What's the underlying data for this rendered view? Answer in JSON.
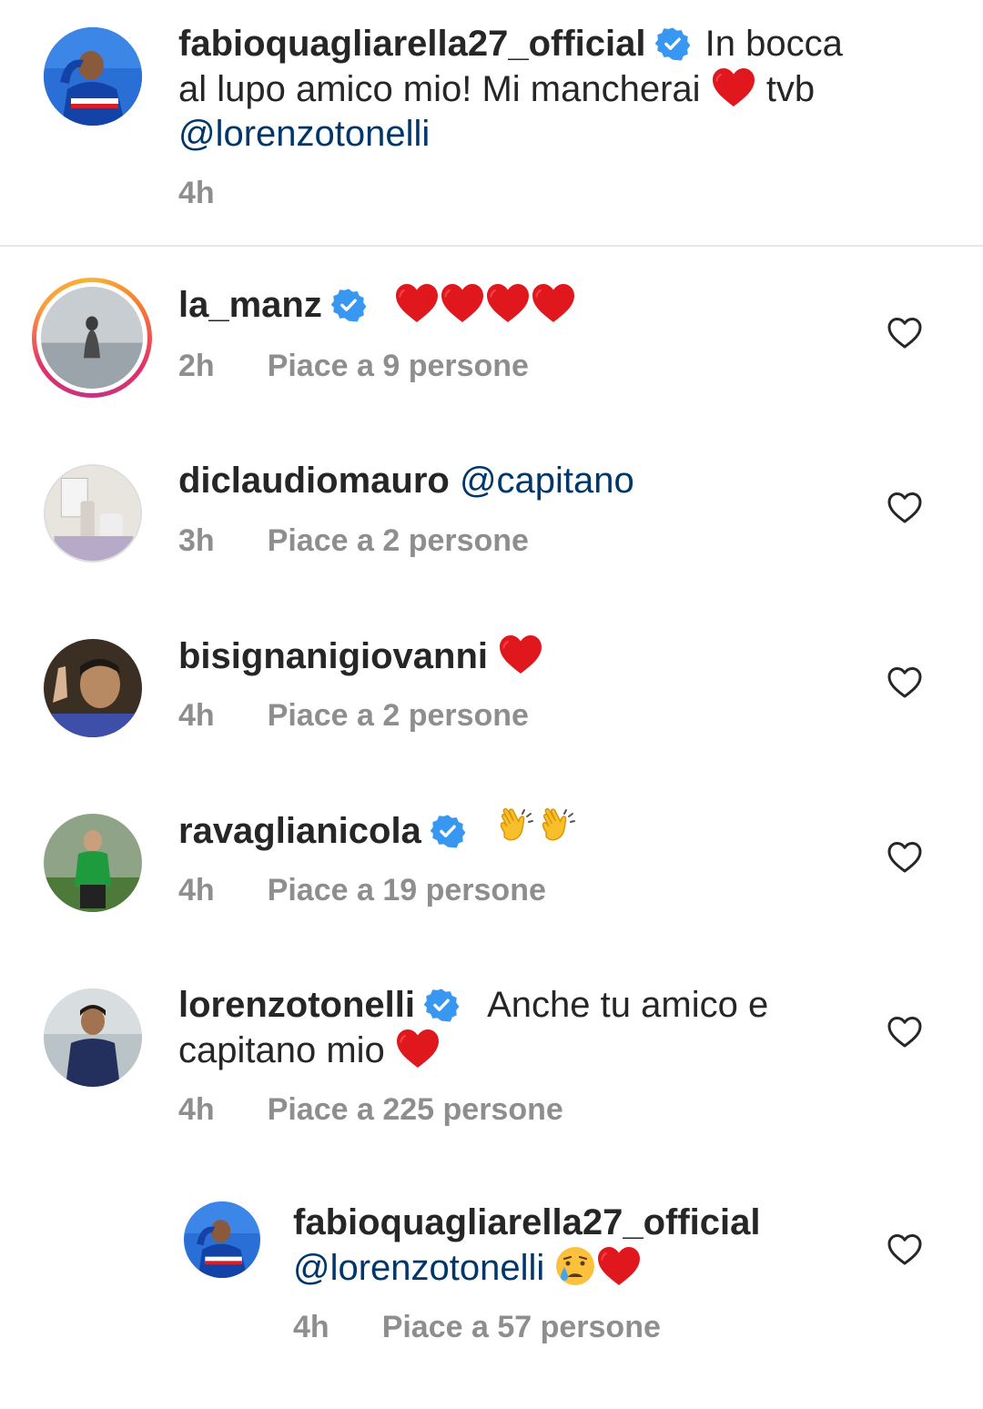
{
  "caption": {
    "username": "fabioquagliarella27_official",
    "text_part1": "In bocca al lupo amico mio! Mi mancherai",
    "text_part2": "tvb",
    "mention": "@lorenzotonelli",
    "time": "4h"
  },
  "comments": [
    {
      "username": "la_manz",
      "verified": true,
      "text": "",
      "time": "2h",
      "likes": "Piace a 9 persone",
      "emoji": "heart x4"
    },
    {
      "username": "diclaudiomauro",
      "verified": false,
      "mention": "@capitano",
      "time": "3h",
      "likes": "Piace a 2 persone"
    },
    {
      "username": "bisignanigiovanni",
      "verified": false,
      "emoji": "heart",
      "time": "4h",
      "likes": "Piace a 2 persone"
    },
    {
      "username": "ravaglianicola",
      "verified": true,
      "emoji": "clap x2",
      "time": "4h",
      "likes": "Piace a 19 persone"
    },
    {
      "username": "lorenzotonelli",
      "verified": true,
      "text_part1": "Anche tu amico e",
      "text_part2": "capitano mio",
      "emoji": "heart",
      "time": "4h",
      "likes": "Piace a 225 persone"
    }
  ],
  "reply": {
    "username": "fabioquagliarella27_official",
    "mention": "@lorenzotonelli",
    "emoji": "cry, heart",
    "time": "4h",
    "likes": "Piace a 57 persone"
  },
  "colors": {
    "verified": "#3897f0",
    "mention": "#00376b",
    "meta": "#8e8e8e",
    "heart_emoji": "#e0181e"
  }
}
